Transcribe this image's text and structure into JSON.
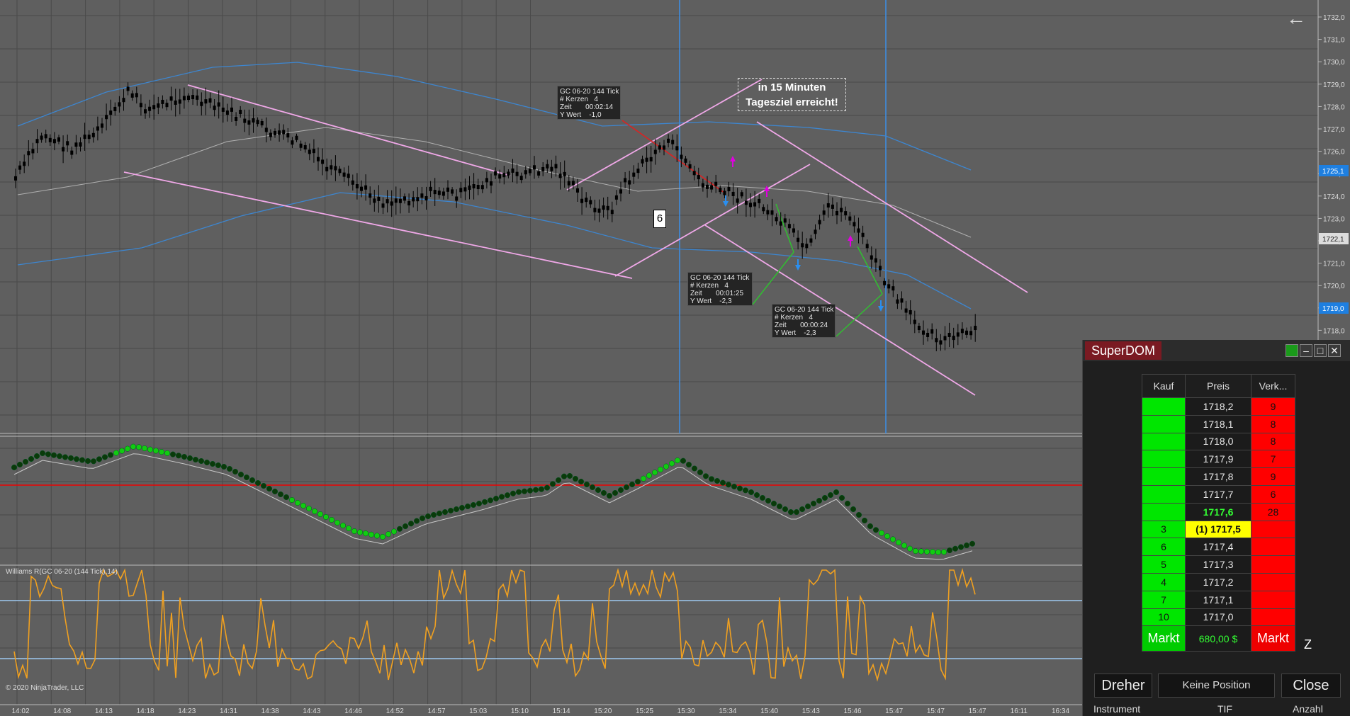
{
  "chart": {
    "price_labels": [
      "1732,0",
      "1731,0",
      "1730,0",
      "1729,0",
      "1728,0",
      "1727,0",
      "1726,0",
      "1725,0",
      "1724,0",
      "1723,0",
      "1722,0",
      "1721,0",
      "1720,0",
      "1719,0",
      "1718,0"
    ],
    "price_tags": [
      {
        "text": "1725,1",
        "color": "#1e7fe0"
      },
      {
        "text": "1722,1",
        "color": "#dddddd"
      },
      {
        "text": "1719,0",
        "color": "#1e7fe0"
      }
    ],
    "time_labels": [
      "14:02",
      "14:08",
      "14:13",
      "14:18",
      "14:23",
      "14:31",
      "14:38",
      "14:43",
      "14:46",
      "14:52",
      "14:57",
      "15:03",
      "15:10",
      "15:14",
      "15:20",
      "15:25",
      "15:30",
      "15:34",
      "15:40",
      "15:43",
      "15:46",
      "15:47",
      "15:47",
      "15:47",
      "16:11",
      "16:34"
    ],
    "indicator_label": "Williams R(GC 06-20 (144 Tick),14)",
    "copyright": "© 2020 NinjaTrader, LLC",
    "six_label": "6",
    "note": {
      "line1": "in 15 Minuten",
      "line2": "Tagesziel erreicht!"
    },
    "back_icon": "left-arrow-icon",
    "info_boxes": [
      {
        "title": "GC 06-20 144 Tick",
        "l1": "# Kerzen   4",
        "l2": "Zeit       00:02:14",
        "l3": "Y Wert    -1,0"
      },
      {
        "title": "GC 06-20 144 Tick",
        "l1": "# Kerzen   4",
        "l2": "Zeit       00:01:25",
        "l3": "Y Wert    -2,3"
      },
      {
        "title": "GC 06-20 144 Tick",
        "l1": "# Kerzen   4",
        "l2": "Zeit       00:00:24",
        "l3": "Y Wert    -2,3"
      }
    ]
  },
  "superdom": {
    "title": "SuperDOM",
    "headers": {
      "bid": "Kauf",
      "price": "Preis",
      "ask": "Verk..."
    },
    "rows": [
      {
        "bid": "",
        "price": "1718,2",
        "ask": "9"
      },
      {
        "bid": "",
        "price": "1718,1",
        "ask": "8"
      },
      {
        "bid": "",
        "price": "1718,0",
        "ask": "8"
      },
      {
        "bid": "",
        "price": "1717,9",
        "ask": "7"
      },
      {
        "bid": "",
        "price": "1717,8",
        "ask": "9"
      },
      {
        "bid": "",
        "price": "1717,7",
        "ask": "6"
      },
      {
        "bid": "",
        "price": "1717,6",
        "ask": "28"
      },
      {
        "bid": "3",
        "price": "(1) 1717,5",
        "ask": ""
      },
      {
        "bid": "6",
        "price": "1717,4",
        "ask": ""
      },
      {
        "bid": "5",
        "price": "1717,3",
        "ask": ""
      },
      {
        "bid": "4",
        "price": "1717,2",
        "ask": ""
      },
      {
        "bid": "7",
        "price": "1717,1",
        "ask": ""
      },
      {
        "bid": "10",
        "price": "1717,0",
        "ask": ""
      }
    ],
    "markt_buy": "Markt",
    "pnl": "680,00 $",
    "markt_sell": "Markt",
    "z_label": "Z",
    "dreher": "Dreher",
    "position": "Keine Position",
    "close": "Close",
    "footer": {
      "instrument": "Instrument",
      "tif": "TIF",
      "anzahl": "Anzahl"
    }
  }
}
